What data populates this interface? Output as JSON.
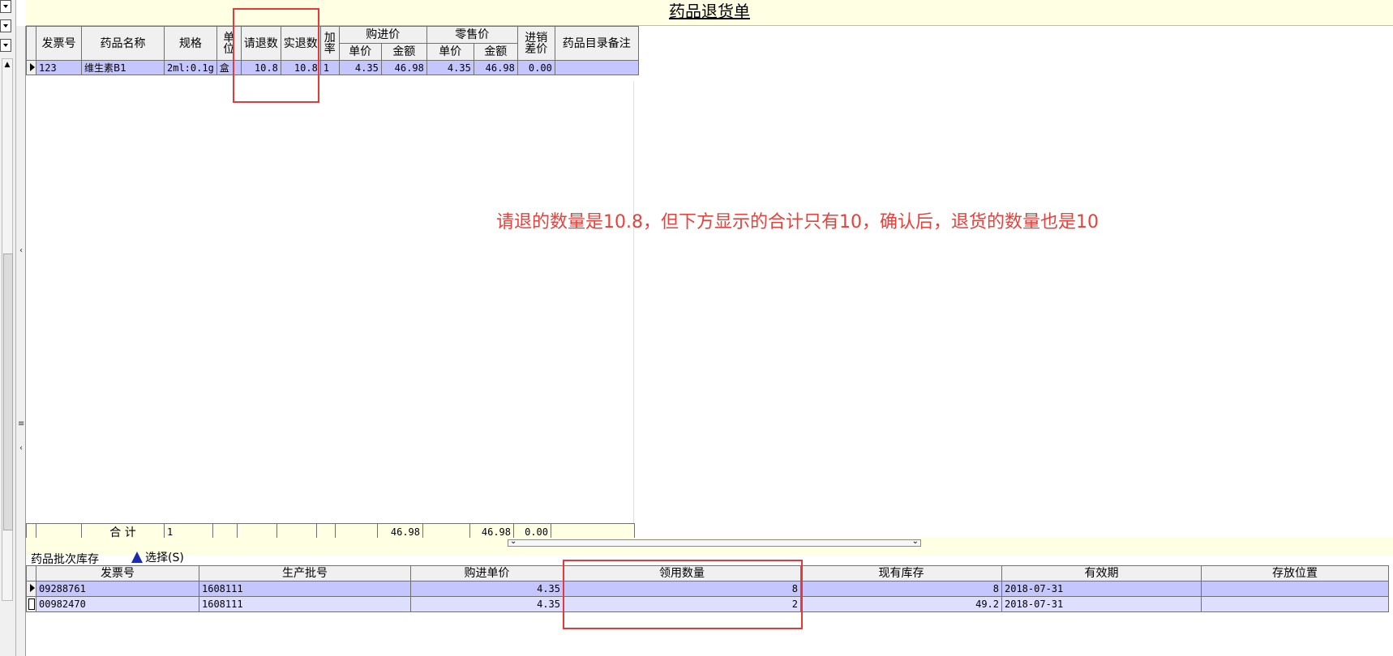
{
  "form_title": "药品退货单",
  "main_grid": {
    "headers": {
      "invoice_no": "发票号",
      "drug_name": "药品名称",
      "spec": "规格",
      "unit": "单位",
      "request_qty": "请退数",
      "actual_qty": "实退数",
      "markup_rate": "加率",
      "purchase_price": "购进价",
      "retail_price": "零售价",
      "unit_price": "单价",
      "amount": "金额",
      "price_diff": "进销差价",
      "catalog_note": "药品目录备注"
    },
    "row": {
      "invoice_no": "123",
      "drug_name": "维生素B1",
      "spec": "2ml:0.1g",
      "unit": "盒",
      "request_qty": "10.8",
      "actual_qty": "10.8",
      "markup_rate": "1",
      "purchase_unit_price": "4.35",
      "purchase_amount": "46.98",
      "retail_unit_price": "4.35",
      "retail_amount": "46.98",
      "price_diff": "0.00",
      "catalog_note": ""
    },
    "totals": {
      "label": "合 计",
      "count": "1",
      "purchase_amount": "46.98",
      "retail_amount": "46.98",
      "price_diff": "0.00"
    }
  },
  "annotation": "请退的数量是10.8，但下方显示的合计只有10，确认后，退货的数量也是10",
  "annotation_color": "#e8403a",
  "batch_section": {
    "label": "药品批次库存",
    "choose_button": "选择(S)",
    "choose_icon": "blue-arrow-up-icon",
    "headers": [
      "发票号",
      "生产批号",
      "购进单价",
      "领用数量",
      "现有库存",
      "有效期",
      "存放位置"
    ],
    "rows": [
      {
        "invoice_no": "09288761",
        "batch_no": "1608111",
        "unit_price": "4.35",
        "qty": "8",
        "stock": "8",
        "expiry": "2018-07-31",
        "location": ""
      },
      {
        "invoice_no": "00982470",
        "batch_no": "1608111",
        "unit_price": "4.35",
        "qty": "2",
        "stock": "49.2",
        "expiry": "2018-07-31",
        "location": ""
      }
    ]
  },
  "colors": {
    "header_bg": "#f0f0f0",
    "selected_row": "#c6c6ff",
    "alt_row": "#dedeff",
    "title_band": "#ffffe3",
    "highlight_box": "#e53a3a"
  }
}
